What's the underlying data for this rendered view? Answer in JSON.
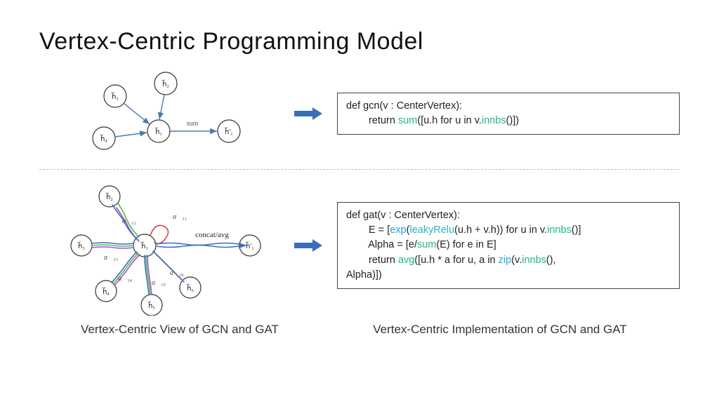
{
  "title": "Vertex-Centric Programming Model",
  "gcn_diagram": {
    "center_label": "h⃗₁",
    "neighbors": [
      "h⃗₃",
      "h⃗₂",
      "h⃗₄"
    ],
    "output_label": "h⃗'₁",
    "edge_label": "sum"
  },
  "gat_diagram": {
    "center_label": "h⃗₁",
    "neighbors": [
      "h⃗₂",
      "h⃗₃",
      "h⃗₄",
      "h⃗₅",
      "h⃗₆"
    ],
    "output_label": "h⃗'₁",
    "alphas": [
      "α⃗₁₁",
      "α⃗₁₂",
      "α⃗₁₃",
      "α⃗₁₄",
      "α⃗₁₅",
      "α⃗₁₆"
    ],
    "out_edge_label": "concat/avg"
  },
  "code": {
    "gcn": {
      "l1_a": "def gcn(v : CenterVertex):",
      "l2_a": "return ",
      "l2_sum": "sum",
      "l2_b": "([u.h for u in v.",
      "l2_innbs": "innbs",
      "l2_c": "()])"
    },
    "gat": {
      "l1": "def gat(v : CenterVertex):",
      "l2_a": "E = [",
      "l2_exp": "exp",
      "l2_b": "(",
      "l2_lr": "leakyRelu",
      "l2_c": "(u.h + v.h)) for u in v.",
      "l2_innbs": "innbs",
      "l2_d": "()]",
      "l3_a": "Alpha = [e/",
      "l3_sum": "sum",
      "l3_b": "(E) for e in E]",
      "l4_a": "return ",
      "l4_avg": "avg",
      "l4_b": "([u.h * a for u, a in ",
      "l4_zip": "zip",
      "l4_c": "(v.",
      "l4_innbs": "innbs",
      "l4_d": "(),",
      "l5": "Alpha)])"
    }
  },
  "captions": {
    "left": "Vertex-Centric View of GCN and GAT",
    "right": "Vertex-Centric Implementation of GCN and GAT"
  }
}
